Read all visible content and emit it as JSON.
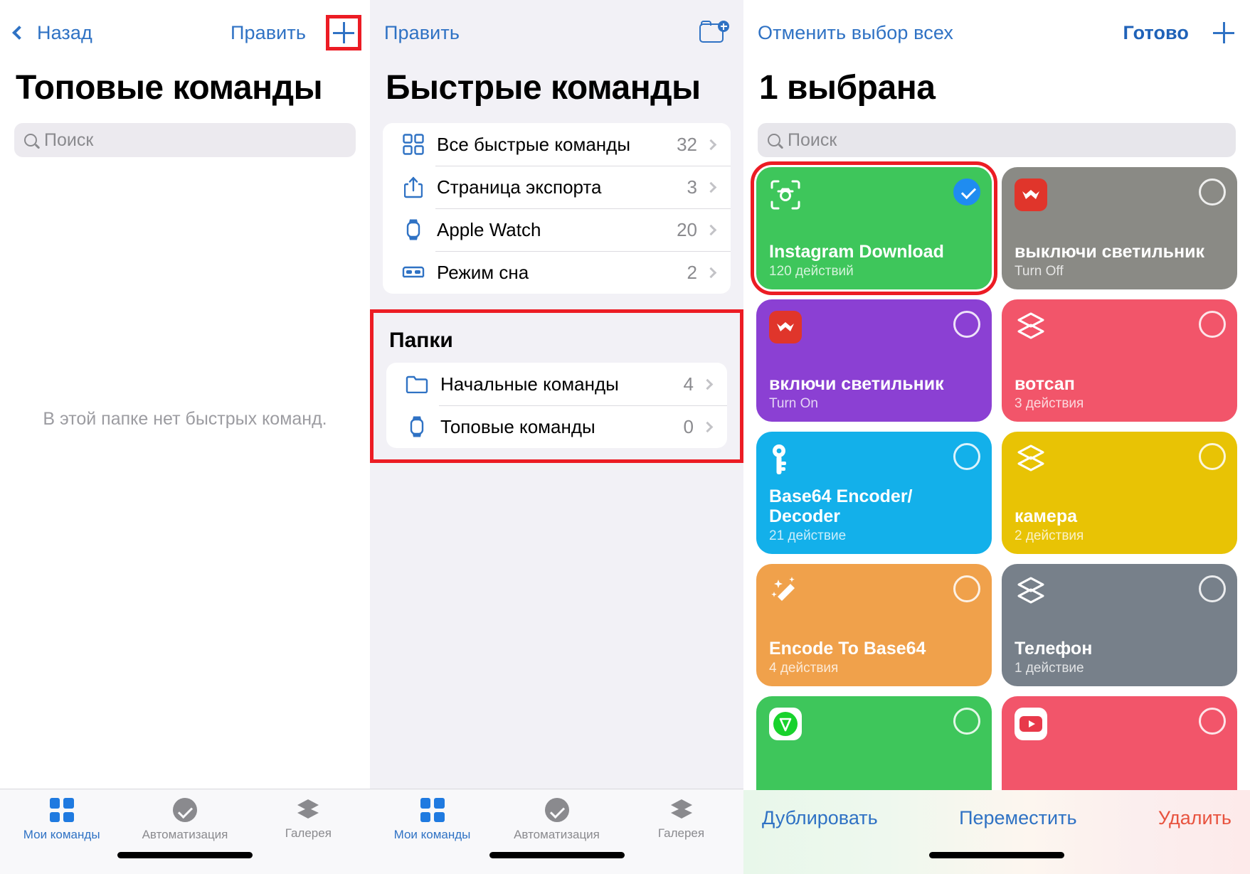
{
  "panel1": {
    "nav": {
      "back": "Назад",
      "edit": "Править",
      "add_icon": "plus-icon"
    },
    "title": "Топовые команды",
    "search_placeholder": "Поиск",
    "empty_message": "В этой папке нет быстрых команд."
  },
  "panel2": {
    "nav": {
      "edit": "Править",
      "new_folder_icon": "folder-plus-icon"
    },
    "title": "Быстрые команды",
    "list": [
      {
        "icon": "grid-icon",
        "label": "Все быстрые команды",
        "count": "32"
      },
      {
        "icon": "share-icon",
        "label": "Страница экспорта",
        "count": "3"
      },
      {
        "icon": "watch-icon",
        "label": "Apple Watch",
        "count": "20"
      },
      {
        "icon": "bed-icon",
        "label": "Режим сна",
        "count": "2"
      }
    ],
    "folders_title": "Папки",
    "folders": [
      {
        "icon": "folder-icon",
        "label": "Начальные команды",
        "count": "4"
      },
      {
        "icon": "watch-icon",
        "label": "Топовые команды",
        "count": "0"
      }
    ]
  },
  "panel3": {
    "nav": {
      "deselect_all": "Отменить выбор всех",
      "done": "Готово",
      "add_icon": "plus-icon"
    },
    "title": "1 выбрана",
    "search_placeholder": "Поиск",
    "cards": [
      {
        "title": "Instagram Download",
        "subtitle": "120 действий",
        "color": "#3ec65b",
        "icon": "camera-frame-icon",
        "selected": true,
        "highlighted": true
      },
      {
        "title": "выключи светильник",
        "subtitle": "Turn Off",
        "color": "#8a8a85",
        "icon": "yeelight-icon",
        "selected": false,
        "highlighted": false
      },
      {
        "title": "включи светильник",
        "subtitle": "Turn On",
        "color": "#8b40d3",
        "icon": "yeelight-icon",
        "selected": false,
        "highlighted": false
      },
      {
        "title": "вотсап",
        "subtitle": "3 действия",
        "color": "#f2556a",
        "icon": "layers-icon",
        "selected": false,
        "highlighted": false
      },
      {
        "title": "Base64 Encoder/ Decoder",
        "subtitle": "21 действие",
        "color": "#13b0ea",
        "icon": "key-icon",
        "selected": false,
        "highlighted": false
      },
      {
        "title": "камера",
        "subtitle": "2 действия",
        "color": "#e8c305",
        "icon": "layers-icon",
        "selected": false,
        "highlighted": false
      },
      {
        "title": "Encode To Base64",
        "subtitle": "4 действия",
        "color": "#f0a14b",
        "icon": "magic-wand-icon",
        "selected": false,
        "highlighted": false
      },
      {
        "title": "Телефон",
        "subtitle": "1 действие",
        "color": "#77808a",
        "icon": "layers-icon",
        "selected": false,
        "highlighted": false
      },
      {
        "title": "",
        "subtitle": "",
        "color": "#3ec65b",
        "icon": "brave-icon",
        "selected": false,
        "highlighted": false
      },
      {
        "title": "",
        "subtitle": "",
        "color": "#f2556a",
        "icon": "youtube-icon",
        "selected": false,
        "highlighted": false
      }
    ],
    "actions": {
      "duplicate": "Дублировать",
      "move": "Переместить",
      "delete": "Удалить"
    }
  },
  "tabbar": {
    "tabs": [
      {
        "label": "Мои команды",
        "icon": "grid-icon",
        "active": true
      },
      {
        "label": "Автоматизация",
        "icon": "clock-icon",
        "active": false
      },
      {
        "label": "Галерея",
        "icon": "stack-icon",
        "active": false
      }
    ]
  },
  "colors": {
    "accent": "#2f72c4",
    "highlight": "#ec1c24",
    "danger": "#e8533f"
  }
}
